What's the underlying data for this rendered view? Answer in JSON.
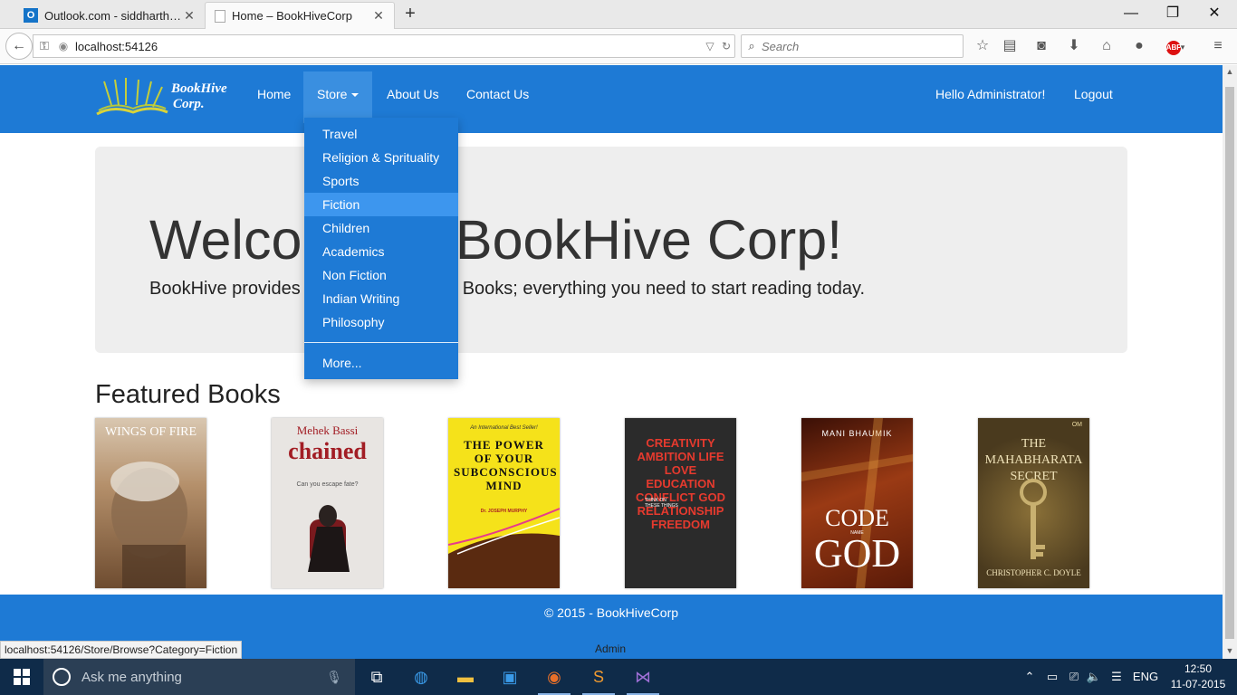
{
  "browser": {
    "tabs": [
      {
        "title": "Outlook.com - siddharth.s...",
        "icon": "outlook-icon"
      },
      {
        "title": "Home – BookHiveCorp",
        "icon": "page-icon"
      }
    ],
    "url": "localhost:54126",
    "search_placeholder": "Search",
    "status_url": "localhost:54126/Store/Browse?Category=Fiction"
  },
  "site": {
    "logo_line1": "BookHive",
    "logo_line2": "Corp.",
    "nav": {
      "home": "Home",
      "store": "Store",
      "about": "About Us",
      "contact": "Contact Us",
      "greeting": "Hello Administrator!",
      "logout": "Logout"
    },
    "dropdown": {
      "items": [
        "Travel",
        "Religion & Sprituality",
        "Sports",
        "Fiction",
        "Children",
        "Academics",
        "Non Fiction",
        "Indian Writing",
        "Philosophy"
      ],
      "active": "Fiction",
      "more": "More..."
    },
    "jumbotron": {
      "heading": "Welcome to BookHive Corp!",
      "tagline": "BookHive provides you with millions of Books; everything you need to start reading today."
    },
    "featured_title": "Featured Books",
    "books": [
      {
        "title": "WINGS OF FIRE",
        "author": "",
        "color": "#7a5a3a"
      },
      {
        "title": "chained",
        "author": "Mehek Bassi",
        "sub": "Can you escape fate?",
        "color": "#e9e6e4"
      },
      {
        "title": "THE POWER OF YOUR SUBCONSCIOUS MIND",
        "author": "Dr. JOSEPH MURPHY",
        "top": "An International Best Seller!",
        "color": "#f5e21a"
      },
      {
        "title": "CREATIVITY AMBITION LIFE LOVE EDUCATION CONFLICT GOD RELATIONSHIP FREEDOM",
        "sub": "THINK ON THESE THINGS",
        "color": "#2b2b2b"
      },
      {
        "title": "CODE GOD",
        "middle": "NAME",
        "author": "MANI BHAUMIK",
        "color": "#7a2c12"
      },
      {
        "title": "THE MAHABHARATA SECRET",
        "author": "CHRISTOPHER C. DOYLE",
        "top": "OM",
        "color": "#4a3a1e"
      }
    ],
    "footer": {
      "copyright": "© 2015 - BookHiveCorp",
      "admin": "Admin"
    }
  },
  "taskbar": {
    "search_placeholder": "Ask me anything",
    "language": "ENG",
    "time": "12:50",
    "date": "11-07-2015"
  },
  "colors": {
    "brand_blue": "#1e7ad5",
    "dropdown_active": "#3d96ee",
    "taskbar": "#0f2b49"
  }
}
